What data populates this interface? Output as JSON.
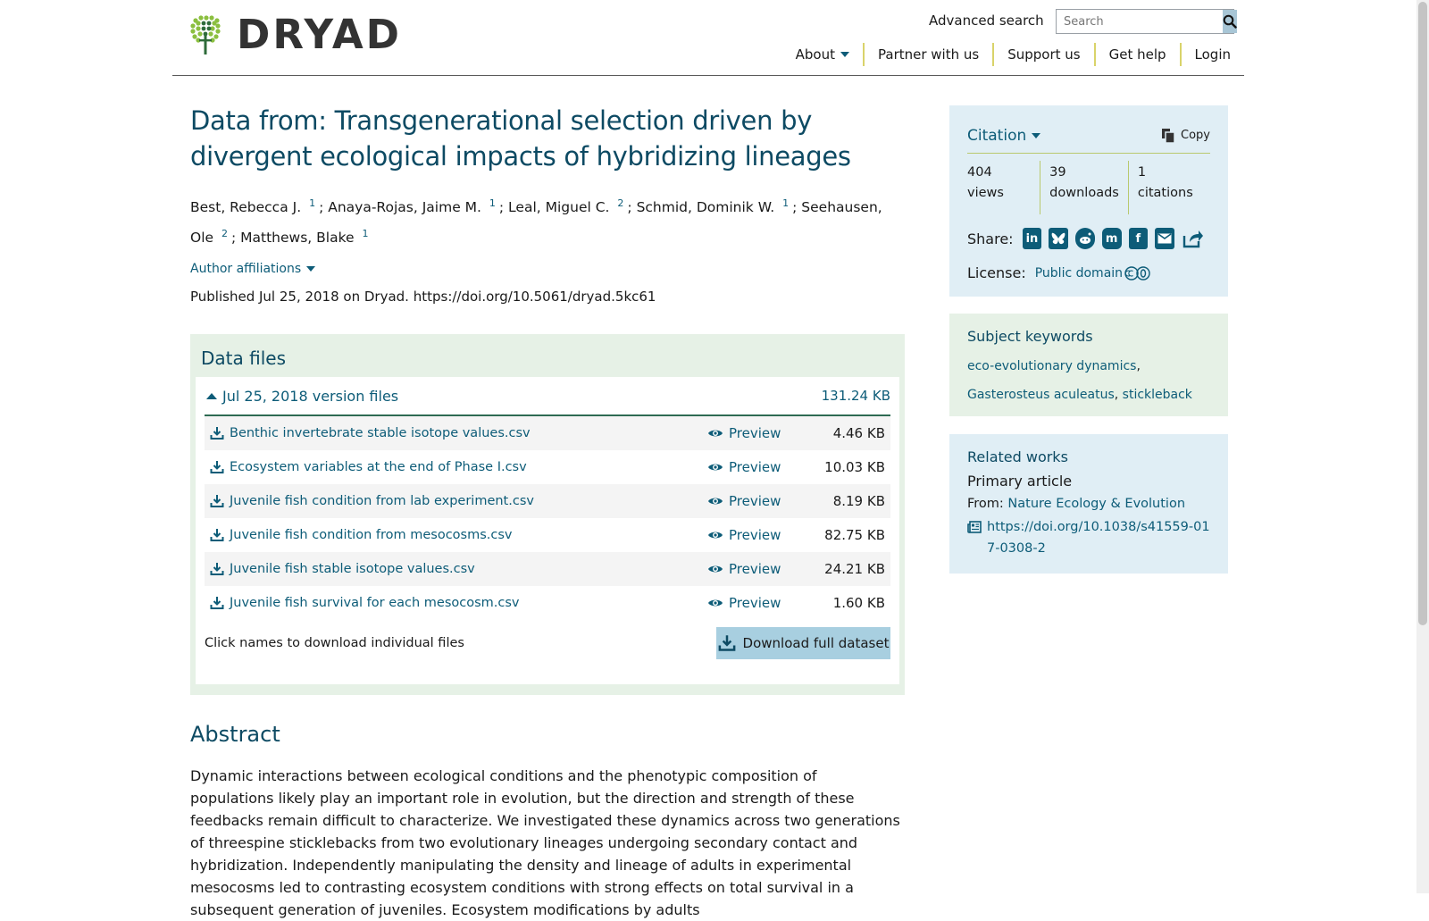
{
  "header": {
    "logo_text": "DRYAD",
    "advanced_search": "Advanced search",
    "search_placeholder": "Search",
    "nav": [
      "About",
      "Partner with us",
      "Support us",
      "Get help",
      "Login"
    ]
  },
  "dataset": {
    "title": "Data from: Transgenerational selection driven by divergent ecological impacts of hybridizing lineages",
    "authors": [
      {
        "name": "Best, Rebecca J.",
        "aff": "1"
      },
      {
        "name": "Anaya-Rojas, Jaime M.",
        "aff": "1"
      },
      {
        "name": "Leal, Miguel C.",
        "aff": "2"
      },
      {
        "name": "Schmid, Dominik W.",
        "aff": "1"
      },
      {
        "name": "Seehausen, Ole",
        "aff": "2"
      },
      {
        "name": "Matthews, Blake",
        "aff": "1"
      }
    ],
    "author_affiliations": "Author affiliations",
    "published": "Published Jul 25, 2018 on Dryad. https://doi.org/10.5061/dryad.5kc61"
  },
  "data_files": {
    "heading": "Data files",
    "version_label": "Jul 25, 2018 version files",
    "version_size": "131.24 KB",
    "preview_label": "Preview",
    "files": [
      {
        "name": "Benthic invertebrate stable isotope values.csv",
        "size": "4.46 KB"
      },
      {
        "name": "Ecosystem variables at the end of Phase I.csv",
        "size": "10.03 KB"
      },
      {
        "name": "Juvenile fish condition from lab experiment.csv",
        "size": "8.19 KB"
      },
      {
        "name": "Juvenile fish condition from mesocosms.csv",
        "size": "82.75 KB"
      },
      {
        "name": "Juvenile fish stable isotope values.csv",
        "size": "24.21 KB"
      },
      {
        "name": "Juvenile fish survival for each mesocosm.csv",
        "size": "1.60 KB"
      }
    ],
    "hint": "Click names to download individual files",
    "download_full": "Download full dataset"
  },
  "abstract": {
    "heading": "Abstract",
    "text": "Dynamic interactions between ecological conditions and the phenotypic composition of populations likely play an important role in evolution, but the direction and strength of these feedbacks remain difficult to characterize. We investigated these dynamics across two generations of threespine sticklebacks from two evolutionary lineages undergoing secondary contact and hybridization. Independently manipulating the density and lineage of adults in experimental mesocosms led to contrasting ecosystem conditions with strong effects on total survival in a subsequent generation of juveniles. Ecosystem modifications by adults"
  },
  "citation": {
    "label": "Citation",
    "copy": "Copy",
    "metrics": [
      {
        "value": "404",
        "label": "views"
      },
      {
        "value": "39",
        "label": "downloads"
      },
      {
        "value": "1",
        "label": "citations"
      }
    ],
    "share_label": "Share:",
    "license_label": "License:",
    "license_value": "Public domain"
  },
  "keywords": {
    "title": "Subject keywords",
    "items": [
      "eco-evolutionary dynamics",
      "Gasterosteus aculeatus",
      "stickleback"
    ]
  },
  "related": {
    "title": "Related works",
    "subtitle": "Primary article",
    "from_label": "From:",
    "from_journal": "Nature Ecology & Evolution",
    "doi": "https://doi.org/10.1038/s41559-017-0308-2"
  },
  "colors": {
    "title": "#0d4a63",
    "link": "#0d5c78",
    "panel_blue": "#e0eef5",
    "panel_green": "#e6f1e6",
    "divider": "#d9d36a"
  }
}
